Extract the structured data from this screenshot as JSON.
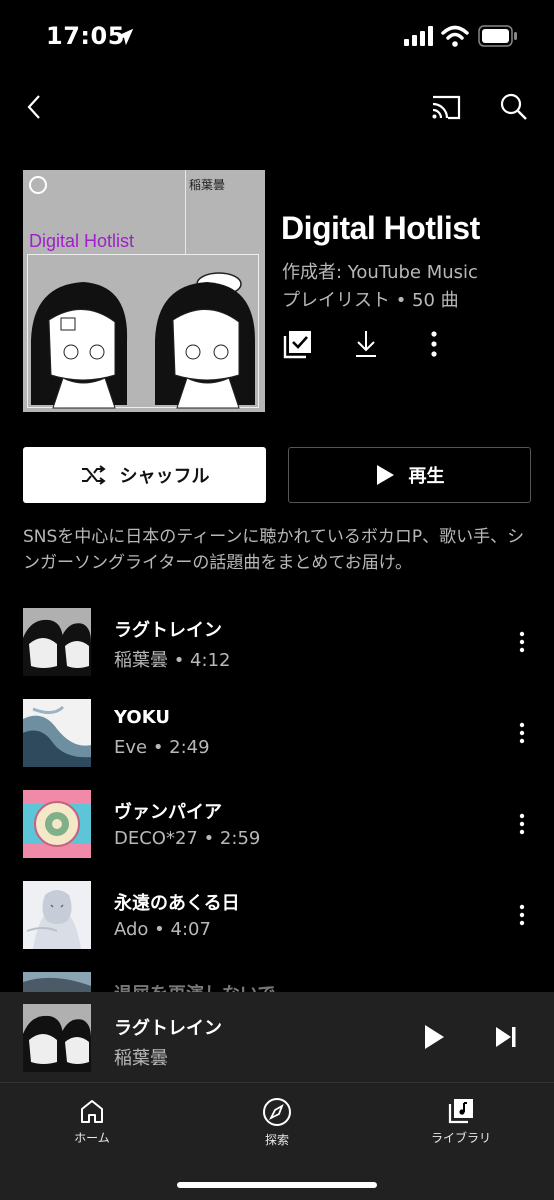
{
  "status_bar": {
    "time": "17:05"
  },
  "nav": {
    "back_icon": "chevron-left-icon",
    "cast_icon": "cast-icon",
    "search_icon": "search-icon"
  },
  "playlist": {
    "cover_artist": "稲葉曇",
    "cover_title": "Digital Hotlist",
    "title": "Digital Hotlist",
    "author": "作成者: YouTube Music",
    "meta": "プレイリスト • 50 曲",
    "description": "SNSを中心に日本のティーンに聴かれているボカロP、歌い手、シンガーソングライターの話題曲をまとめてお届け。",
    "accent_color": "#a020c8"
  },
  "buttons": {
    "shuffle_label": "シャッフル",
    "play_label": "再生"
  },
  "songs": [
    {
      "title": "ラグトレイン",
      "subtitle": "稲葉曇 • 4:12"
    },
    {
      "title": "YOKU",
      "subtitle": "Eve • 2:49"
    },
    {
      "title": "ヴァンパイア",
      "subtitle": "DECO*27 • 2:59"
    },
    {
      "title": "永遠のあくる日",
      "subtitle": "Ado • 4:07"
    },
    {
      "title": "退屈を再演しないで"
    }
  ],
  "mini_player": {
    "title": "ラグトレイン",
    "artist": "稲葉曇"
  },
  "bottom_nav": {
    "home": "ホーム",
    "explore": "探索",
    "library": "ライブラリ"
  }
}
